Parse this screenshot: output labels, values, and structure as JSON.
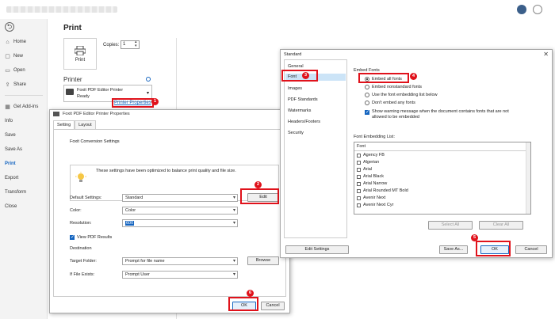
{
  "sidebar": {
    "back": "⮌",
    "items": [
      {
        "label": "Home",
        "icon": "⌂"
      },
      {
        "label": "New",
        "icon": "▢"
      },
      {
        "label": "Open",
        "icon": "▭"
      },
      {
        "label": "Share",
        "icon": "⇪"
      },
      {
        "label": "Get Add-ins",
        "icon": "▦"
      },
      {
        "label": "Info",
        "icon": ""
      },
      {
        "label": "Save",
        "icon": ""
      },
      {
        "label": "Save As",
        "icon": ""
      },
      {
        "label": "Print",
        "icon": ""
      },
      {
        "label": "Export",
        "icon": ""
      },
      {
        "label": "Transform",
        "icon": ""
      },
      {
        "label": "Close",
        "icon": ""
      }
    ],
    "active": "Print"
  },
  "print": {
    "title": "Print",
    "button": "Print",
    "copies_label": "Copies:",
    "copies_value": "1",
    "printer_header": "Printer",
    "printer_name": "Foxit PDF Editor Printer",
    "printer_status": "Ready",
    "properties_link": "Printer Properties"
  },
  "foxit_dialog": {
    "title": "Foxit PDF Editor Printer Properties",
    "tabs": [
      "Setting",
      "Layout"
    ],
    "section_title": "Foxit Conversion Settings",
    "info_text": "These settings have been optimized to balance print quality and file size.",
    "default_settings_label": "Default Settings:",
    "default_settings_value": "Standard",
    "edit_button": "Edit",
    "color_label": "Color:",
    "color_value": "Color",
    "resolution_label": "Resolution:",
    "resolution_value": "600",
    "view_results": "View PDF Results",
    "destination": "Destination",
    "target_folder_label": "Target Folder:",
    "target_folder_value": "Prompt for file name",
    "browse_button": "Browse",
    "if_exists_label": "If File Exists:",
    "if_exists_value": "Prompt User",
    "ok": "OK",
    "cancel": "Cancel"
  },
  "standard_dialog": {
    "title": "Standard",
    "close": "✕",
    "categories": [
      "General",
      "Font",
      "Images",
      "PDF Standards",
      "Watermarks",
      "Headers/Footers",
      "Security"
    ],
    "selected_category": "Font",
    "embed_fonts_title": "Embed Fonts",
    "options": [
      "Embed all fonts",
      "Embed nonstandard fonts",
      "Use the font embedding list below",
      "Don't embed any fonts"
    ],
    "warning_text": "Show warning message when the document contains fonts that are not allowed to be embedded",
    "list_title": "Font Embedding List:",
    "list_header": "Font",
    "fonts": [
      "Agency FB",
      "Algerian",
      "Arial",
      "Arial Black",
      "Arial Narrow",
      "Arial Rounded MT Bold",
      "Avenir Next",
      "Avenir Next Cyr"
    ],
    "select_all": "Select All",
    "clear_all": "Clear All",
    "edit_settings": "Edit Settings",
    "save_as": "Save As...",
    "ok": "OK",
    "cancel": "Cancel"
  },
  "badges": [
    "1",
    "2",
    "3",
    "4",
    "5",
    "6"
  ],
  "colors": {
    "accent": "#1565c0",
    "highlight": "#e0121b",
    "selection": "#cce4f7"
  }
}
